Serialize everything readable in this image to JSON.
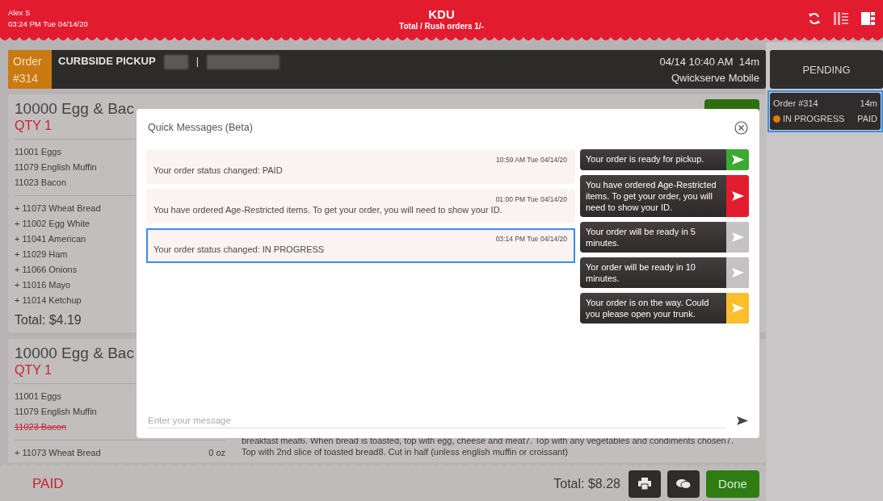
{
  "header": {
    "user": "Alex S",
    "datetime": "03:24 PM Tue 04/14/20",
    "title": "KDU",
    "subtitle": "Total / Rush orders 1/-"
  },
  "order": {
    "label": "Order",
    "number": "#314",
    "type": "CURBSIDE PICKUP",
    "separator": "|",
    "time": "04/14 10:40 AM",
    "age": "14m",
    "source": "Qwickserve Mobile"
  },
  "cards": [
    {
      "title": "10000 Egg & Bac",
      "qty": "QTY 1",
      "action_button": true,
      "items": [
        {
          "text": "11001 Eggs",
          "struck": false
        },
        {
          "text": "11079 English Muffin",
          "struck": false
        },
        {
          "text": "11023 Bacon",
          "struck": false
        }
      ],
      "modifiers": [
        {
          "text": "+ 11073 Wheat Bread"
        },
        {
          "text": "+ 11002 Egg White"
        },
        {
          "text": "+ 11041 American"
        },
        {
          "text": "+ 11029 Ham"
        },
        {
          "text": "+ 11066 Onions"
        },
        {
          "text": "+ 11016 Mayo"
        },
        {
          "text": "+ 11014 Ketchup"
        }
      ],
      "total": "Total: $4.19"
    },
    {
      "title": "10000 Egg & Bac",
      "qty": "QTY 1",
      "action_button": false,
      "items": [
        {
          "text": "11001 Eggs",
          "struck": false
        },
        {
          "text": "11079 English Muffin",
          "struck": false
        },
        {
          "text": "11023 Bacon",
          "struck": true
        }
      ],
      "modifiers": [
        {
          "text": "+ 11073 Wheat Bread",
          "amount": "0 oz"
        }
      ],
      "instructions": "breakfast meat6. When bread is toasted, top with egg, cheese and meat7. Top with any vegetables and condiments chosen7. Top with 2nd slice of toasted bread8. Cut in half (unless english muffin or croissant)"
    }
  ],
  "footer": {
    "status": "PAID",
    "total": "Total: $8.28",
    "done": "Done"
  },
  "side": {
    "pending": "PENDING",
    "orders": [
      {
        "title": "Order #314",
        "age": "14m",
        "status": "IN PROGRESS",
        "color": "#e07b00",
        "payment": "PAID",
        "selected": true
      }
    ]
  },
  "modal": {
    "title": "Quick Messages (Beta)",
    "messages": [
      {
        "time": "10:59 AM Tue 04/14/20",
        "text": "Your order status changed: PAID",
        "selected": false
      },
      {
        "time": "01:00 PM Tue 04/14/20",
        "text": "You have ordered Age-Restricted items. To get your order, you will need to show your ID.",
        "selected": false
      },
      {
        "time": "03:14 PM Tue 04/14/20",
        "text": "Your order status changed: IN PROGRESS",
        "selected": true
      }
    ],
    "quick_replies": [
      {
        "text": "Your order is ready for pickup.",
        "color": "#3aaa35"
      },
      {
        "text": "You have ordered Age-Restricted items. To get your order, you will need to show your ID.",
        "color": "#e31b2f"
      },
      {
        "text": "Your order will be ready in 5 minutes.",
        "color": "#c4c2c3"
      },
      {
        "text": "Yor order will be ready in 10 minutes.",
        "color": "#c4c2c3"
      },
      {
        "text": "Your order is on the way. Could you please open your trunk.",
        "color": "#fbbf2c"
      }
    ],
    "input": {
      "placeholder": "Enter your message"
    }
  }
}
